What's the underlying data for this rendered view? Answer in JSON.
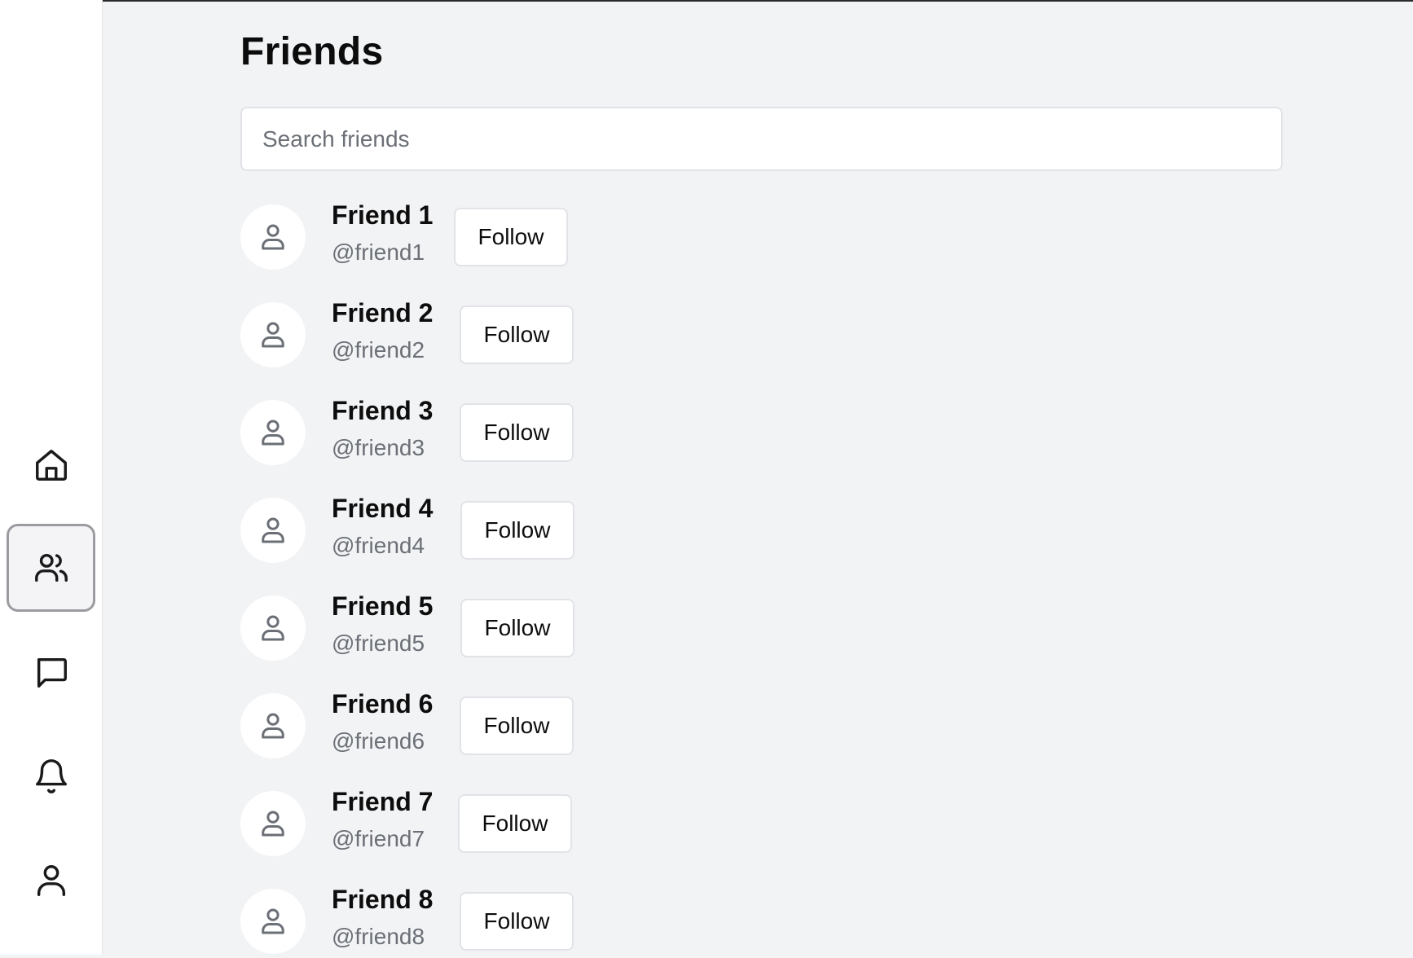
{
  "sidebar": {
    "items": [
      {
        "name": "nav-home",
        "icon": "home-icon",
        "active": false
      },
      {
        "name": "nav-friends",
        "icon": "users-icon",
        "active": true
      },
      {
        "name": "nav-messages",
        "icon": "message-square-icon",
        "active": false
      },
      {
        "name": "nav-notifications",
        "icon": "bell-icon",
        "active": false
      },
      {
        "name": "nav-profile",
        "icon": "user-icon",
        "active": false
      }
    ]
  },
  "page": {
    "title": "Friends"
  },
  "search": {
    "placeholder": "Search friends",
    "value": ""
  },
  "friends": [
    {
      "name": "Friend 1",
      "handle": "@friend1",
      "button": "Follow"
    },
    {
      "name": "Friend 2",
      "handle": "@friend2",
      "button": "Follow"
    },
    {
      "name": "Friend 3",
      "handle": "@friend3",
      "button": "Follow"
    },
    {
      "name": "Friend 4",
      "handle": "@friend4",
      "button": "Follow"
    },
    {
      "name": "Friend 5",
      "handle": "@friend5",
      "button": "Follow"
    },
    {
      "name": "Friend 6",
      "handle": "@friend6",
      "button": "Follow"
    },
    {
      "name": "Friend 7",
      "handle": "@friend7",
      "button": "Follow"
    },
    {
      "name": "Friend 8",
      "handle": "@friend8",
      "button": "Follow"
    }
  ],
  "colors": {
    "background": "#f2f3f5",
    "surface": "#ffffff",
    "border": "#e1e3e7",
    "muted_text": "#6b6f76",
    "icon": "#1a1a1a",
    "avatar_icon": "#6b6f76"
  }
}
